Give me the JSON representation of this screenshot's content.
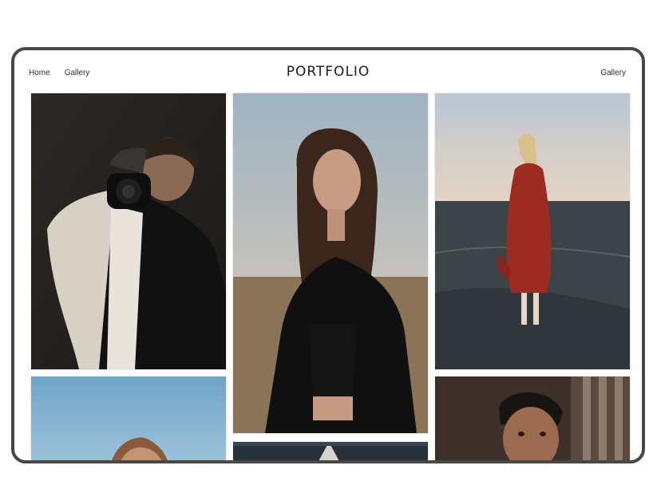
{
  "header": {
    "nav_left": [
      "Home",
      "Gallery"
    ],
    "brand": "PORTFOLIO",
    "nav_right": "Gallery"
  },
  "colors": {
    "frame_border": "#4a4743",
    "text": "#1f1f1f"
  },
  "gallery": [
    {
      "subject": "man-holding-camera"
    },
    {
      "subject": "woman-long-hair-black-jacket"
    },
    {
      "subject": "woman-red-dress-field"
    },
    {
      "subject": "sky-with-figure"
    },
    {
      "subject": "dark-scene"
    },
    {
      "subject": "man-portrait-window"
    }
  ]
}
